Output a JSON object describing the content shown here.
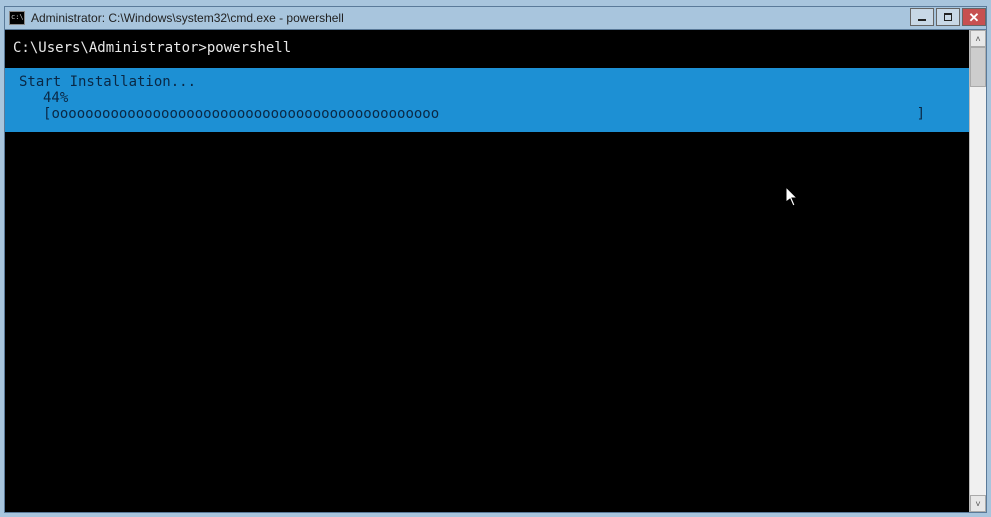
{
  "window": {
    "title": "Administrator: C:\\Windows\\system32\\cmd.exe - powershell"
  },
  "terminal": {
    "prompt": "C:\\Users\\Administrator>powershell",
    "progress": {
      "title": "Start Installation...",
      "percent_text": "44%",
      "bar_open": "[",
      "bar_fill": "oooooooooooooooooooooooooooooooooooooooooooooo",
      "bar_close": "]"
    }
  },
  "scrollbar": {
    "up_glyph": "˄",
    "down_glyph": "˅"
  }
}
